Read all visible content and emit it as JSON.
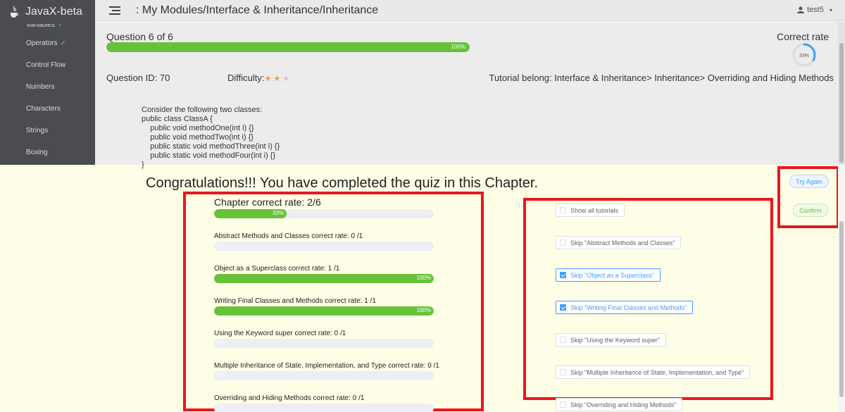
{
  "app": {
    "title": "JavaX-beta"
  },
  "sidebar": {
    "items": [
      {
        "label": "Variables",
        "done": true
      },
      {
        "label": "Operators",
        "done": true
      },
      {
        "label": "Control Flow",
        "done": false
      },
      {
        "label": "Numbers",
        "done": false
      },
      {
        "label": "Characters",
        "done": false
      },
      {
        "label": "Strings",
        "done": false
      },
      {
        "label": "Boxing",
        "done": false
      }
    ],
    "check_glyph": "✓"
  },
  "header": {
    "breadcrumb": ": My Modules/Interface & Inheritance/Inheritance",
    "user": "test5"
  },
  "quiz": {
    "question_title": "Question 6 of 6",
    "progress": 100,
    "progress_text": "100%",
    "correct_rate_label": "Correct rate",
    "correct_rate_value": 33,
    "correct_rate_text": "33%",
    "question_id": "Question ID: 70",
    "difficulty_label": "Difficulty:",
    "difficulty_stars": 2,
    "difficulty_max": 3,
    "tutorial_belong": "Tutorial belong:  Interface & Inheritance> Inheritance> Overriding and Hiding Methods",
    "code": "Consider the following two classes:\npublic class ClassA {\n    public void methodOne(int i) {}\n    public void methodTwo(int i) {}\n    public static void methodThree(int i) {}\n    public static void methodFour(int i) {}\n}"
  },
  "result": {
    "congrats": "Congratulations!!!  You have completed the quiz in this Chapter.",
    "chapter_rate_title": "Chapter correct rate: 2/6",
    "chapter_rate_value": 33,
    "chapter_rate_text": "33%",
    "rates": [
      {
        "label": "Abstract Methods and Classes correct rate:  0 /1",
        "value": 0,
        "text": "0%"
      },
      {
        "label": "Object as a Superclass correct rate:  1 /1",
        "value": 100,
        "text": "100%"
      },
      {
        "label": "Writing Final Classes and Methods correct rate:  1 /1",
        "value": 100,
        "text": "100%"
      },
      {
        "label": "Using the Keyword super correct rate:  0 /1",
        "value": 0,
        "text": "0%"
      },
      {
        "label": "Multiple Inheritance of State, Implementation, and Type correct rate:  0 /1",
        "value": 0,
        "text": "0%"
      },
      {
        "label": "Overriding and Hiding Methods correct rate:  0 /1",
        "value": 0,
        "text": "0%"
      }
    ],
    "checkboxes": [
      {
        "label": "Show all tutorials",
        "checked": false
      },
      {
        "label": "Skip \"Abstract Methods and Classes\"",
        "checked": false
      },
      {
        "label": "Skip \"Object as a Superclass\"",
        "checked": true
      },
      {
        "label": "Skip \"Writing Final Classes and Methods\"",
        "checked": true
      },
      {
        "label": "Skip \"Using the Keyword super\"",
        "checked": false
      },
      {
        "label": "Skip \"Multiple Inheritance of State, Implementation, and Type\"",
        "checked": false
      },
      {
        "label": "Skip \"Overriding and Hiding Methods\"",
        "checked": false
      }
    ],
    "try_again_label": "Try Again",
    "confirm_label": "Confirm"
  },
  "colors": {
    "success": "#67c23a",
    "primary": "#409eff",
    "highlight_border": "#e8171f",
    "sidebar_bg": "#4a4c50",
    "star": "#e6a23c"
  }
}
